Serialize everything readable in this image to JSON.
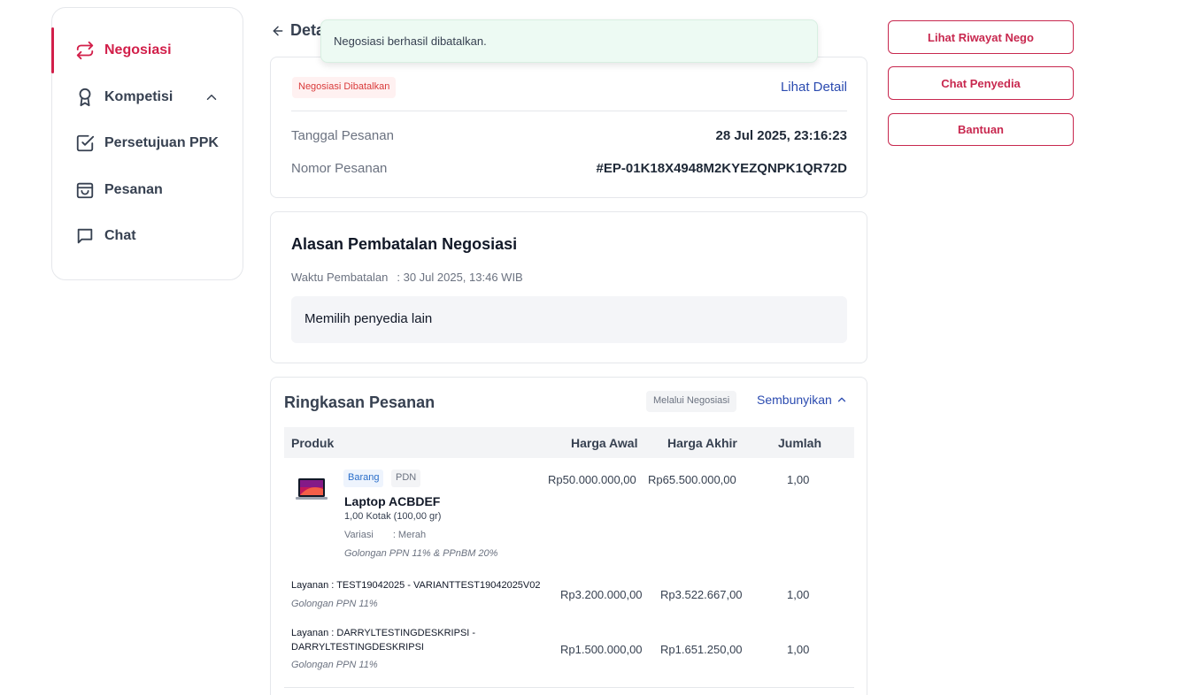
{
  "sidebar": {
    "items": [
      {
        "label": "Negosiasi",
        "icon": "swap-arrows-icon",
        "active": true
      },
      {
        "label": "Kompetisi",
        "icon": "award-ribbon-icon"
      },
      {
        "label": "Persetujuan PPK",
        "icon": "checkbox-icon"
      },
      {
        "label": "Pesanan",
        "icon": "shopping-bag-icon"
      },
      {
        "label": "Chat",
        "icon": "chat-bubble-icon"
      }
    ]
  },
  "header": {
    "title": "Deta"
  },
  "toast": {
    "message": "Negosiasi berhasil dibatalkan."
  },
  "order": {
    "status": "Negosiasi Dibatalkan",
    "detail_link": "Lihat Detail",
    "date_label": "Tanggal Pesanan",
    "date_value": "28 Jul 2025, 23:16:23",
    "number_label": "Nomor Pesanan",
    "number_value": "#EP-01K18X4948M2KYEZQNPK1QR72D"
  },
  "cancellation": {
    "title": "Alasan Pembatalan Negosiasi",
    "time_label": "Waktu Pembatalan",
    "time_value": ": 30 Jul 2025, 13:46 WIB",
    "reason": "Memilih penyedia lain"
  },
  "summary": {
    "title": "Ringkasan Pesanan",
    "via_badge": "Melalui Negosiasi",
    "toggle_label": "Sembunyikan",
    "columns": [
      "Produk",
      "Harga Awal",
      "Harga Akhir",
      "Jumlah"
    ],
    "product": {
      "tags": [
        "Barang",
        "PDN"
      ],
      "name": "Laptop ACBDEF",
      "qty_detail": "1,00 Kotak (100,00 gr)",
      "variant_label": "Variasi",
      "variant_value": ": Merah",
      "tax": "Golongan PPN 11% & PPnBM 20%",
      "price_initial": "Rp50.000.000,00",
      "price_final": "Rp65.500.000,00",
      "quantity": "1,00"
    },
    "services": [
      {
        "label_prefix": "Layanan : ",
        "label_line1": "TEST19042025 - VARIANTTEST19042025V02",
        "label_line2": "",
        "tax": "Golongan PPN 11%",
        "price_initial": "Rp3.200.000,00",
        "price_final": "Rp3.522.667,00",
        "quantity": "1,00"
      },
      {
        "label_prefix": "Layanan : ",
        "label_line1": "DARRYLTESTINGDESKRIPSI -",
        "label_line2": "DARRYLTESTINGDESKRIPSI",
        "tax": "Golongan PPN 11%",
        "price_initial": "Rp1.500.000,00",
        "price_final": "Rp1.651.250,00",
        "quantity": "1,00"
      }
    ]
  },
  "actions": {
    "history": "Lihat Riwayat Nego",
    "chat": "Chat Penyedia",
    "help": "Bantuan"
  },
  "colors": {
    "brand": "#d21f4a",
    "link": "#2b4bb0",
    "toast_bg": "#edfaf3"
  }
}
